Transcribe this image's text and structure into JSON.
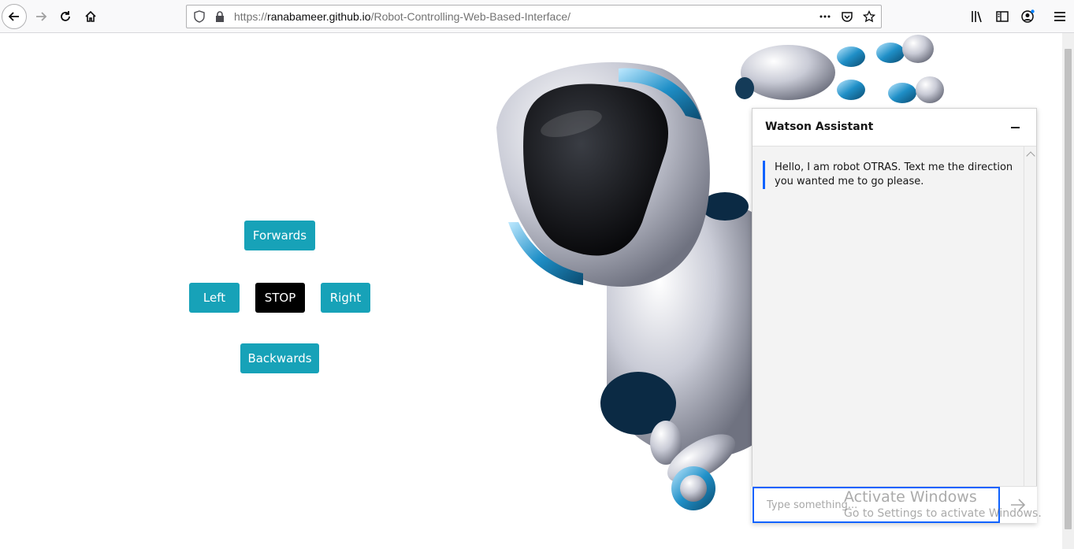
{
  "browser": {
    "url_prefix": "https://",
    "url_domain": "ranabameer.github.io",
    "url_path": "/Robot-Controlling-Web-Based-Interface/"
  },
  "controls": {
    "forwards": "Forwards",
    "left": "Left",
    "stop": "STOP",
    "right": "Right",
    "backwards": "Backwards"
  },
  "watson": {
    "title": "Watson Assistant",
    "message": "Hello, I am robot OTRAS. Text me the direction you wanted me to go please.",
    "input_placeholder": "Type something..."
  },
  "watermark": {
    "line1": "Activate Windows",
    "line2": "Go to Settings to activate Windows."
  },
  "colors": {
    "button": "#17a2b8",
    "stop": "#000000",
    "accent": "#0f62fe"
  }
}
